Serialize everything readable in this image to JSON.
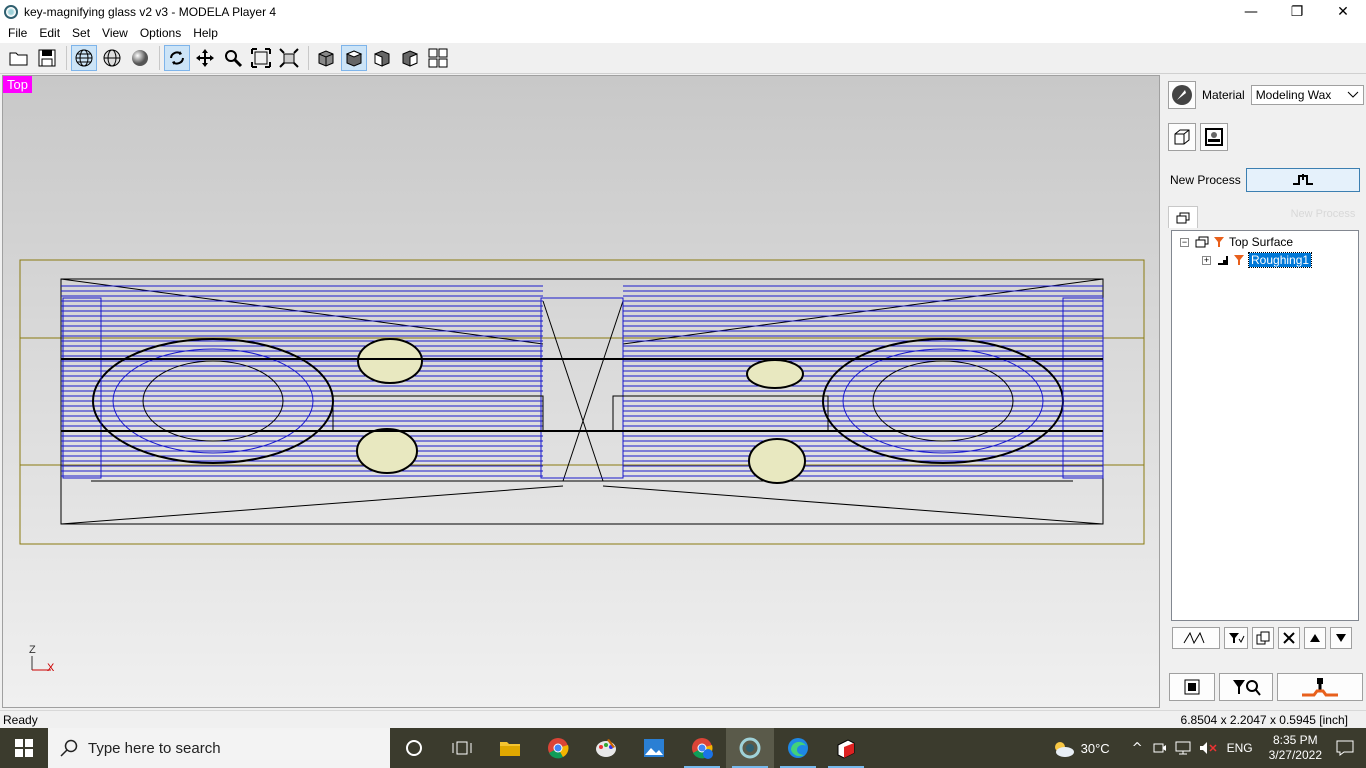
{
  "window": {
    "title": "key-magnifying glass v2 v3 - MODELA Player 4",
    "controls": {
      "minimize": "—",
      "restore": "❐",
      "close": "✕"
    }
  },
  "menu": [
    "File",
    "Edit",
    "Set",
    "View",
    "Options",
    "Help"
  ],
  "toolbar": {
    "buttons": [
      "open-icon",
      "save-icon",
      "wireframe-icon",
      "mesh-icon",
      "shaded-icon",
      "rotate-icon",
      "pan-icon",
      "zoom-icon",
      "zoom-fit-icon",
      "zoom-box-icon",
      "view-iso-icon",
      "view-top-icon",
      "view-front-icon",
      "view-side-icon",
      "view-quad-icon"
    ]
  },
  "viewport": {
    "view_label": "Top",
    "axis_z": "Z",
    "axis_x": "X"
  },
  "panel": {
    "material_label": "Material",
    "material_value": "Modeling Wax",
    "new_process_label": "New Process",
    "new_process_ghost": "New Process",
    "tree": {
      "root": "Top Surface",
      "child": "Roughing1"
    }
  },
  "status": {
    "left": "Ready",
    "right": "6.8504 x 2.2047 x 0.5945 [inch]"
  },
  "taskbar": {
    "search_placeholder": "Type here to search",
    "weather": "30°C",
    "language": "ENG",
    "time": "8:35 PM",
    "date": "3/27/2022"
  },
  "colors": {
    "accent": "#0078d7",
    "toolpath": "#1a1acc",
    "view_tag": "#ff00ff",
    "boundary": "#8a7a10"
  }
}
